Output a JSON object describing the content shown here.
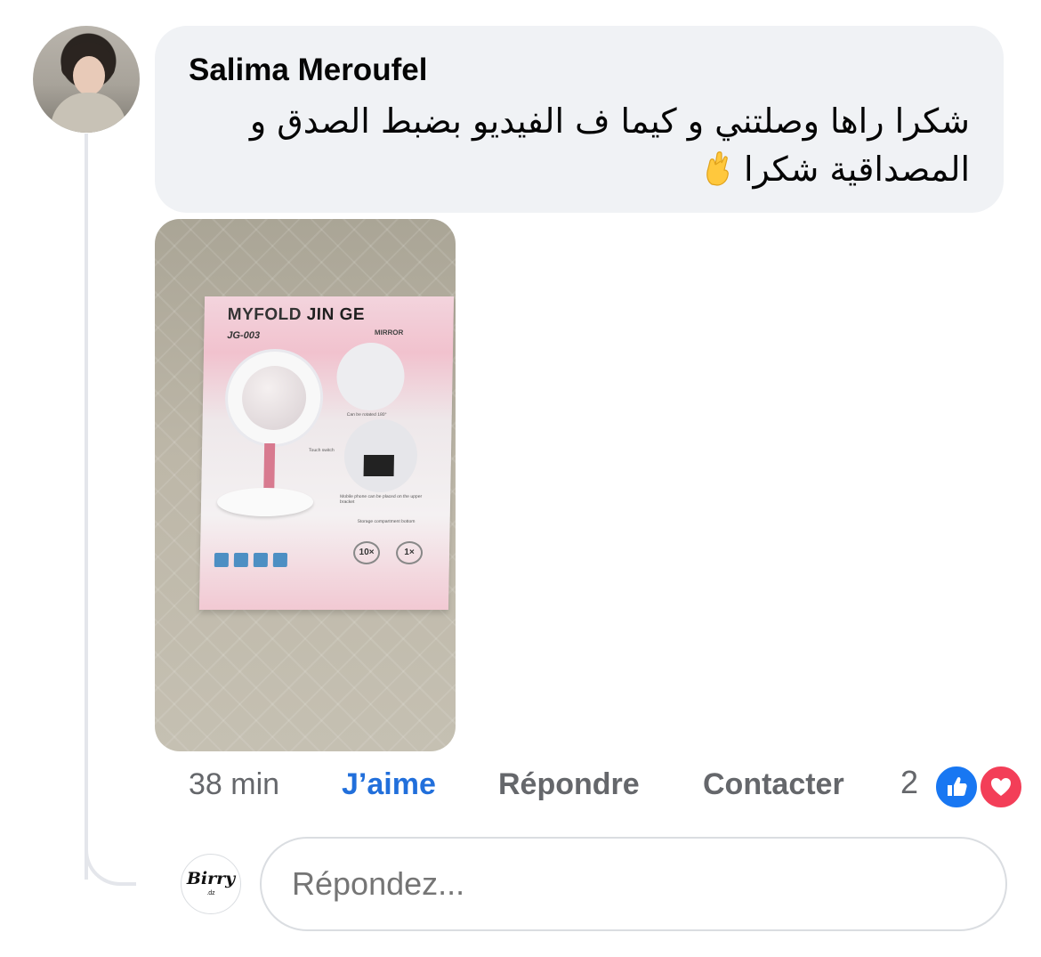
{
  "comment": {
    "author": "Salima Meroufel",
    "text": "شكرا راها وصلتني و كيما ف الفيديو بضبط الصدق و المصداقية شكرا",
    "emoji": "crossed-fingers",
    "time": "38 min",
    "reaction_count": "2",
    "actions": {
      "like": "J’aime",
      "reply": "Répondre",
      "contact": "Contacter"
    }
  },
  "photo": {
    "brand_part1": "MYFOLD",
    "brand_part2": "JIN GE",
    "model": "JG-003",
    "subtitle": "MIRROR",
    "caption_rotate": "Can be rotated 180°",
    "caption_touch": "Touch switch",
    "caption_phone": "Mobile phone can be placed on the upper bracket",
    "caption_storage": "Storage compartment bottom",
    "zoom_a": "10×",
    "zoom_b": "1×"
  },
  "reply": {
    "avatar_logo": "Birry",
    "avatar_sub": ".dz",
    "placeholder": "Répondez..."
  },
  "colors": {
    "link_blue": "#216fdb",
    "bubble_bg": "#f0f2f5",
    "meta_gray": "#65676b",
    "like_blue": "#1877f2",
    "love_red": "#f33e58"
  }
}
